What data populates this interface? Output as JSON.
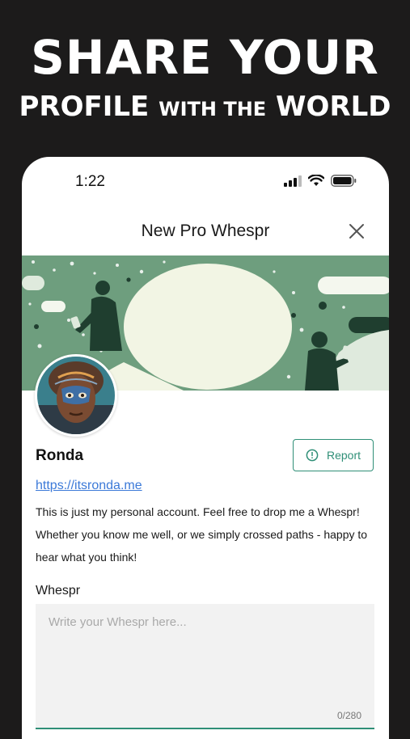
{
  "promo": {
    "headline_line1": "SHARE YOUR",
    "headline_profile": "PROFILE",
    "headline_with_the": "WITH THE",
    "headline_world": "WORLD"
  },
  "status_bar": {
    "time": "1:22"
  },
  "header": {
    "title": "New Pro Whespr",
    "close_icon": "close-icon"
  },
  "profile": {
    "name": "Ronda",
    "link": "https://itsronda.me",
    "bio": "This is just my personal account. Feel free to drop me a Whespr! Whether you know me well, or we simply crossed paths - happy to hear what you think!"
  },
  "report_button": {
    "label": "Report",
    "icon": "alert-circle-icon"
  },
  "whespr_form": {
    "label": "Whespr",
    "placeholder": "Write your Whespr here...",
    "value": "",
    "counter": "0/280"
  },
  "colors": {
    "accent": "#2f8f77",
    "banner_green": "#6e9e7e",
    "link": "#3b79d8",
    "background": "#1c1b1b"
  }
}
